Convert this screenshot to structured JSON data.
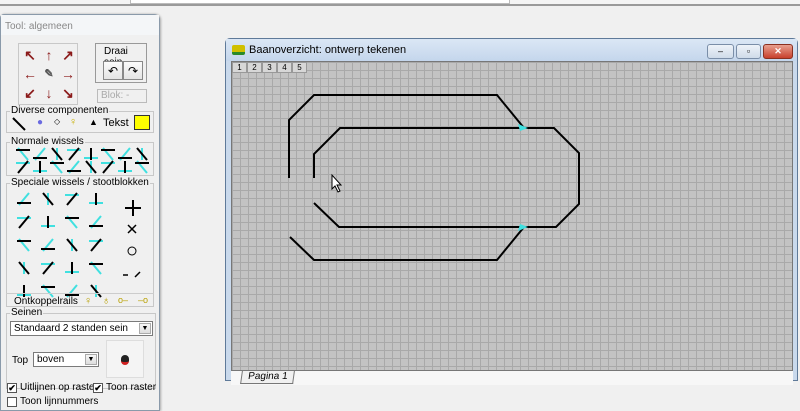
{
  "toolbox": {
    "title": "Tool: algemeen",
    "draai_label": "Draai sein",
    "blok_label": "Blok: -",
    "diverse_label": "Diverse componenten",
    "tekst_label": "Tekst",
    "normale_label": "Normale wissels",
    "speciale_label": "Speciale wissels / stootblokken",
    "ontkoppel_label": "Ontkoppelrails",
    "seinen_label": "Seinen",
    "sein_type": "Standaard 2 standen sein",
    "top_label": "Top",
    "top_value": "boven",
    "uitlijnen_label": "Uitlijnen op raster",
    "uitlijnen_checked": true,
    "toon_raster_label": "Toon raster",
    "toon_raster_checked": true,
    "lijnnummers_label": "Toon lijnnummers",
    "lijnnummers_checked": false,
    "accent": "#ffff00",
    "turnout_color": "#40e0e0",
    "arrow_color": "#8b1a1a"
  },
  "window": {
    "title": "Baanoverzicht: ontwerp tekenen",
    "layers": [
      "1",
      "2",
      "3",
      "4",
      "5"
    ],
    "page_tab": "Pagina 1"
  }
}
